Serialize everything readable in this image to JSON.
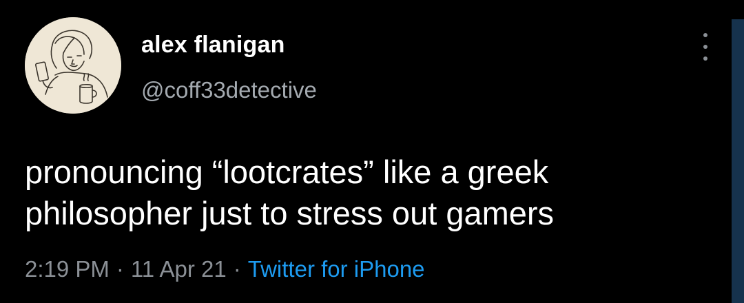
{
  "user": {
    "display_name": "alex flanigan",
    "handle": "@coff33detective",
    "avatar_icon": "avatar-sketch-icon"
  },
  "menu": {
    "icon": "more-options-icon"
  },
  "tweet": {
    "lines": [
      "pronouncing “lootcrates” like a greek",
      "philosopher just to stress out gamers"
    ]
  },
  "meta": {
    "time": "2:19 PM",
    "separator": "·",
    "date": "11 Apr 21",
    "source": "Twitter for iPhone"
  },
  "colors": {
    "background": "#000000",
    "text": "#ffffff",
    "muted": "#8b9096",
    "accent": "#1d9bf0"
  }
}
